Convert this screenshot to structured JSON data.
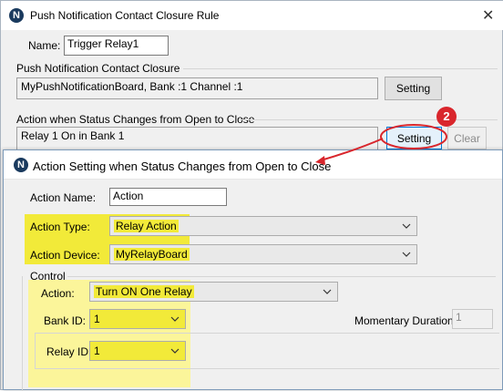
{
  "outer": {
    "title": "Push Notification Contact Closure Rule",
    "name_label": "Name:",
    "name_value": "Trigger Relay1",
    "group1_title": "Push Notification Contact Closure",
    "group1_value": "MyPushNotificationBoard, Bank :1 Channel :1",
    "group1_button": "Setting",
    "group2_title": "Action when Status Changes from Open to Close",
    "group2_value": "Relay 1 On in Bank 1",
    "group2_button": "Setting",
    "clear_button": "Clear",
    "callout_number": "2"
  },
  "inner": {
    "title": "Action Setting when Status Changes from Open to Close",
    "action_name_label": "Action Name:",
    "action_name_value": "Action",
    "action_type_label": "Action Type:",
    "action_type_value": "Relay Action",
    "action_device_label": "Action Device:",
    "action_device_value": "MyRelayBoard",
    "control_label": "Control",
    "action_label": "Action:",
    "action_value": "Turn ON One Relay",
    "bank_id_label": "Bank ID:",
    "bank_id_value": "1",
    "momentary_label": "Momentary Duration:",
    "momentary_value": "1",
    "relay_id_label": "Relay ID:",
    "relay_id_value": "1"
  },
  "colors": {
    "highlight": "#f2ea39",
    "callout": "#d9262c",
    "logo": "#1a3a5e"
  }
}
